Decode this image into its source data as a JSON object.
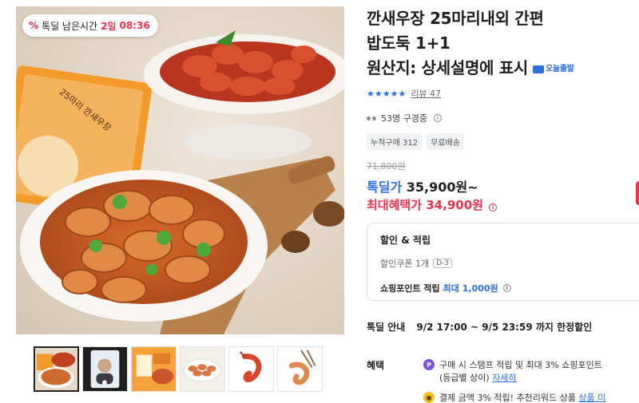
{
  "gallery": {
    "timer_badge": {
      "icon": "percent-icon",
      "label": "톡딜 남은시간",
      "days": "2일",
      "time": "08:36"
    },
    "box_label_top": "25마리 깐새우장",
    "box_label_side": "간편밥도둑",
    "thumbnails": [
      {
        "name": "thumb-main-shrimp"
      },
      {
        "name": "thumb-video-person"
      },
      {
        "name": "thumb-package"
      },
      {
        "name": "thumb-platter"
      },
      {
        "name": "thumb-single-shrimp-red"
      },
      {
        "name": "thumb-single-shrimp-chopsticks"
      }
    ]
  },
  "product": {
    "title_line1": "깐새우장 25마리내외 간편",
    "title_line2": "밥도둑 1+1",
    "title_line3": "원산지: 상세설명에 표시",
    "tomorrow_badge": "오늘출발",
    "stars": "★★★★★",
    "review_label": "리뷰 47",
    "watchers": "53명 구경중",
    "tags": [
      "누적구매 312",
      "무료배송"
    ],
    "original_price": "71,800원",
    "deal_label": "톡딜가",
    "deal_price": "35,900원~",
    "max_benefit_label": "최대혜택가",
    "max_benefit_price": "34,900원"
  },
  "benefit_box": {
    "title": "할인 & 적립",
    "coupon_label": "할인쿠폰 1개",
    "coupon_dday": "D-3",
    "point_label": "쇼핑포인트 적립",
    "point_value": "최대 1,000원"
  },
  "deal_guide": {
    "label": "톡딜 안내",
    "period": "9/2 17:00 ~ 9/5 23:59 까지 한정할인"
  },
  "perks": {
    "label": "혜택",
    "item1_line1": "구매 시 스탬프 적립 및 최대 3% 쇼핑포인트",
    "item1_line2": "(등급별 상이)",
    "item1_link": "자세히",
    "item2_text": "결제 금액 3% 적립! 추천리워드 상품",
    "item2_link": "상품 미"
  },
  "colors": {
    "accent_blue": "#2d6fe0",
    "accent_red": "#e8344e",
    "point_purple": "#7a55d6",
    "coin_yellow": "#f2c021"
  }
}
